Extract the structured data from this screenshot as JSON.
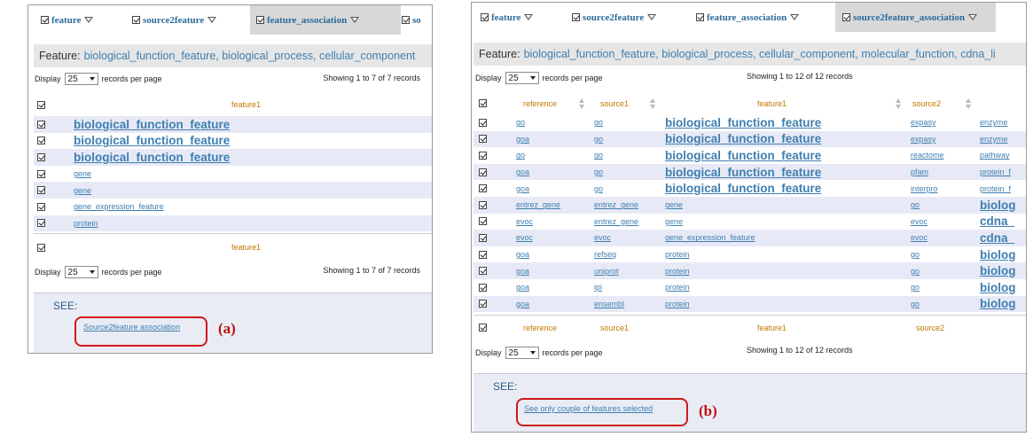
{
  "panel_a": {
    "tabs": [
      {
        "label": "feature",
        "active": false
      },
      {
        "label": "source2feature",
        "active": false
      },
      {
        "label": "feature_association",
        "active": true
      },
      {
        "label": "so",
        "active": false
      }
    ],
    "feature_label": "Feature:",
    "feature_values": "biological_function_feature, biological_process, cellular_component",
    "display_label": "Display",
    "display_value": "25",
    "records_label": "records per page",
    "showing_text": "Showing 1 to 7 of 7 records",
    "column_header": "feature1",
    "rows": [
      {
        "feature1": "biological_function_feature",
        "big": true
      },
      {
        "feature1": "biological_function_feature",
        "big": true
      },
      {
        "feature1": "biological_function_feature",
        "big": true
      },
      {
        "feature1": "gene",
        "big": false
      },
      {
        "feature1": "gene",
        "big": false
      },
      {
        "feature1": "gene_expression_feature",
        "big": false
      },
      {
        "feature1": "protein",
        "big": false
      }
    ],
    "see_label": "SEE:",
    "see_link": "Source2feature association",
    "annotation": "(a)"
  },
  "panel_b": {
    "tabs": [
      {
        "label": "feature",
        "active": false
      },
      {
        "label": "source2feature",
        "active": false
      },
      {
        "label": "feature_association",
        "active": false
      },
      {
        "label": "source2feature_association",
        "active": true
      }
    ],
    "feature_label": "Feature:",
    "feature_values": "biological_function_feature, biological_process, cellular_component, molecular_function, cdna_li",
    "display_label": "Display",
    "display_value": "25",
    "records_label": "records per page",
    "showing_text": "Showing 1 to 12 of 12 records",
    "columns": [
      "reference",
      "source1",
      "feature1",
      "source2"
    ],
    "rows": [
      {
        "reference": "go",
        "source1": "go",
        "feature1": "biological_function_feature",
        "f1_big": true,
        "source2": "expasy",
        "feature2": "enzyme",
        "f2_big": false
      },
      {
        "reference": "goa",
        "source1": "go",
        "feature1": "biological_function_feature",
        "f1_big": true,
        "source2": "expasy",
        "feature2": "enzyme",
        "f2_big": false
      },
      {
        "reference": "go",
        "source1": "go",
        "feature1": "biological_function_feature",
        "f1_big": true,
        "source2": "reactome",
        "feature2": "pathway",
        "f2_big": false
      },
      {
        "reference": "goa",
        "source1": "go",
        "feature1": "biological_function_feature",
        "f1_big": true,
        "source2": "pfam",
        "feature2": "protein_f",
        "f2_big": false
      },
      {
        "reference": "goa",
        "source1": "go",
        "feature1": "biological_function_feature",
        "f1_big": true,
        "source2": "interpro",
        "feature2": "protein_f",
        "f2_big": false
      },
      {
        "reference": "entrez_gene",
        "source1": "entrez_gene",
        "feature1": "gene",
        "f1_big": false,
        "source2": "go",
        "feature2": "biolog",
        "f2_big": true
      },
      {
        "reference": "evoc",
        "source1": "entrez_gene",
        "feature1": "gene",
        "f1_big": false,
        "source2": "evoc",
        "feature2": "cdna_",
        "f2_big": true
      },
      {
        "reference": "evoc",
        "source1": "evoc",
        "feature1": "gene_expression_feature",
        "f1_big": false,
        "source2": "evoc",
        "feature2": "cdna_",
        "f2_big": true
      },
      {
        "reference": "goa",
        "source1": "refseq",
        "feature1": "protein",
        "f1_big": false,
        "source2": "go",
        "feature2": "biolog",
        "f2_big": true
      },
      {
        "reference": "goa",
        "source1": "uniprot",
        "feature1": "protein",
        "f1_big": false,
        "source2": "go",
        "feature2": "biolog",
        "f2_big": true
      },
      {
        "reference": "goa",
        "source1": "ipi",
        "feature1": "protein",
        "f1_big": false,
        "source2": "go",
        "feature2": "biolog",
        "f2_big": true
      },
      {
        "reference": "goa",
        "source1": "ensembl",
        "feature1": "protein",
        "f1_big": false,
        "source2": "go",
        "feature2": "biolog",
        "f2_big": true
      }
    ],
    "see_label": "SEE:",
    "see_link": "See only couple of features selected",
    "annotation": "(b)"
  }
}
